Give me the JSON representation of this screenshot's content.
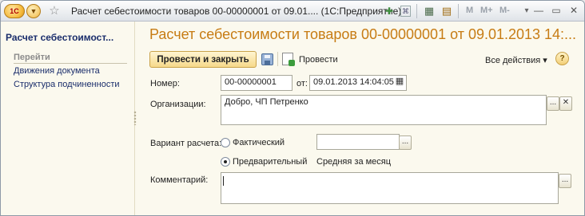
{
  "window": {
    "title": "Расчет себестоимости товаров 00-00000001 от 09.01....  (1С:Предприятие)",
    "logo_text": "1С",
    "icons": [
      "star-icon",
      "add-favorite-icon",
      "link-icon",
      "calculator-icon",
      "calendar-icon"
    ],
    "memory_buttons": [
      "M",
      "M+",
      "M-"
    ],
    "controls": [
      "minimize",
      "maximize",
      "close"
    ]
  },
  "sidebar": {
    "title": "Расчет себестоимост...",
    "section": "Перейти",
    "items": [
      {
        "label": "Движения документа"
      },
      {
        "label": "Структура подчиненности"
      }
    ]
  },
  "document": {
    "title": "Расчет себестоимости товаров 00-00000001 от 09.01.2013 14:..."
  },
  "toolbar": {
    "post_and_close": "Провести и закрыть",
    "post": "Провести",
    "all_actions": "Все действия ▾",
    "help": "?"
  },
  "form": {
    "number_label": "Номер:",
    "number_value": "00-00000001",
    "date_label": "от:",
    "date_value": "09.01.2013 14:04:05",
    "org_label": "Организации:",
    "org_value": "Добро, ЧП Петренко",
    "variant_label": "Вариант расчета:",
    "variant_options": [
      {
        "label": "Фактический",
        "selected": false
      },
      {
        "label": "Предварительный",
        "selected": true
      }
    ],
    "variant_fact_value": "",
    "variant_prelim_value": "Средняя за месяц",
    "comment_label": "Комментарий:",
    "comment_value": ""
  },
  "colors": {
    "title_orange": "#c77c14",
    "nav_blue": "#1a2d6b",
    "panel_bg": "#fbf9ee"
  }
}
